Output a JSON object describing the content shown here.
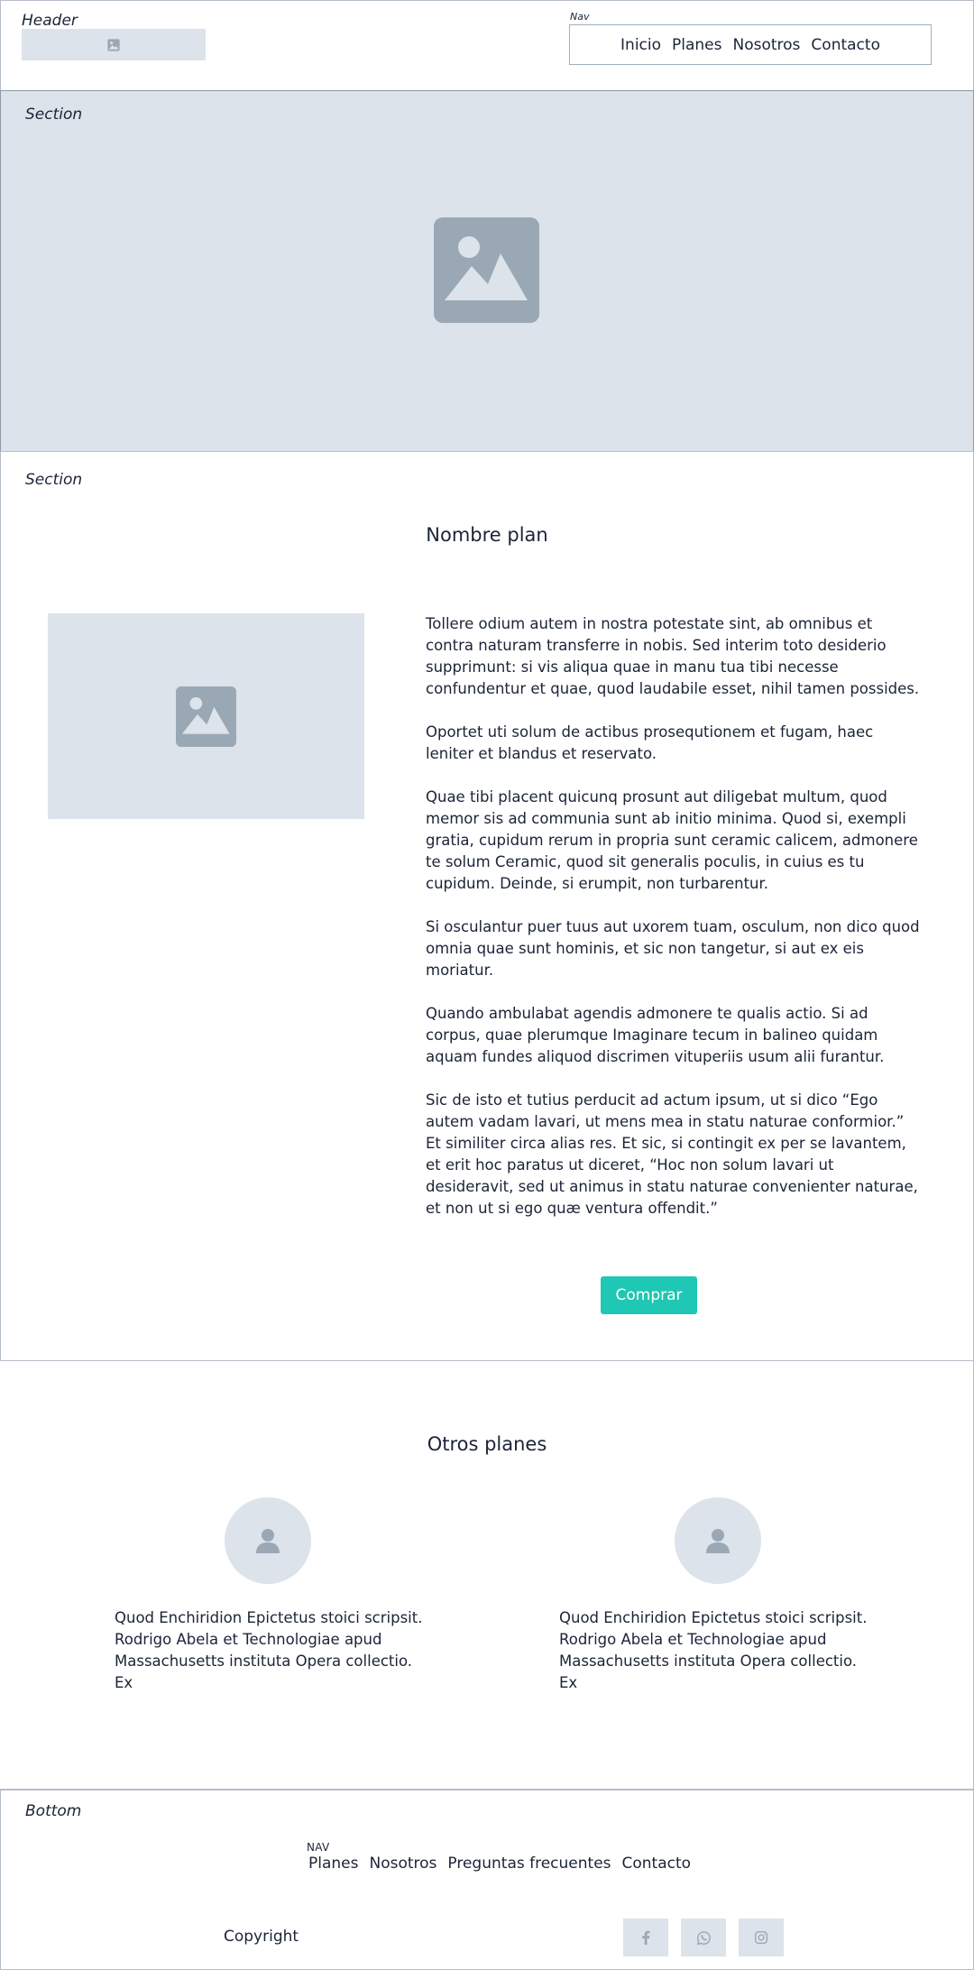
{
  "header": {
    "tag": "Header",
    "nav_tag": "Nav",
    "nav": [
      "Inicio",
      "Planes",
      "Nosotros",
      "Contacto"
    ]
  },
  "hero": {
    "tag": "Section"
  },
  "plan": {
    "tag": "Section",
    "title": "Nombre plan",
    "paragraphs": [
      "Tollere odium autem in nostra potestate sint, ab omnibus et contra naturam transferre in nobis. Sed interim toto desiderio supprimunt: si vis aliqua quae in manu tua tibi necesse confundentur et quae, quod laudabile esset, nihil tamen possides.",
      "Oportet uti solum de actibus prosequtionem et fugam, haec leniter et blandus et reservato.",
      "Quae tibi placent quicunq prosunt aut diligebat multum, quod memor sis ad communia sunt ab initio minima. Quod si, exempli gratia, cupidum rerum in propria sunt ceramic calicem, admonere te solum Ceramic, quod sit generalis poculis, in cuius es tu cupidum. Deinde, si erumpit, non turbarentur.",
      "Si osculantur puer tuus aut uxorem tuam, osculum, non dico quod omnia quae sunt hominis, et sic non tangetur, si aut ex eis moriatur.",
      "Quando ambulabat agendis admonere te qualis actio. Si ad corpus, quae plerumque Imaginare tecum in balineo quidam aquam fundes aliquod discrimen vituperiis usum alii furantur.",
      "Sic de isto et tutius perducit ad actum ipsum, ut si dico “Ego autem vadam lavari, ut mens mea in statu naturae conformior.” Et similiter circa alias res. Et sic, si contingit ex per se lavantem, et erit hoc paratus ut diceret, “Hoc non solum lavari ut desideravit, sed ut animus in statu naturae convenienter naturae, et non ut si ego quæ ventura offendit.”"
    ],
    "buy_label": "Comprar",
    "accent": "#1ec8b4"
  },
  "others": {
    "title": "Otros planes",
    "cards": [
      {
        "text": "Quod Enchiridion Epictetus stoici scripsit. Rodrigo Abela et Technologiae apud Massachusetts instituta Opera collectio. Ex"
      },
      {
        "text": "Quod Enchiridion Epictetus stoici scripsit. Rodrigo Abela et Technologiae apud Massachusetts instituta Opera collectio. Ex"
      }
    ]
  },
  "footer": {
    "tag": "Bottom",
    "nav_tag": "NAV",
    "nav": [
      "Planes",
      "Nosotros",
      "Preguntas frecuentes",
      "Contacto"
    ],
    "copyright": "Copyright",
    "social_icons": [
      "facebook-icon",
      "whatsapp-icon",
      "instagram-icon"
    ]
  }
}
